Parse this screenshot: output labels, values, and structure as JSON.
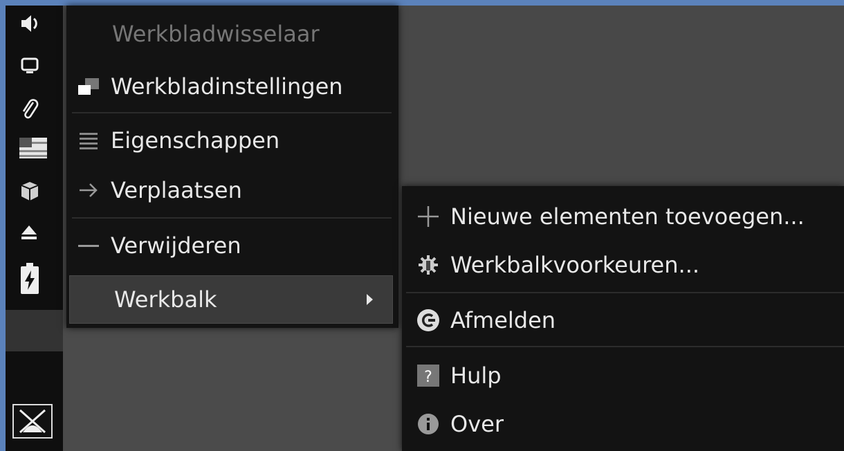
{
  "panel": {
    "icons": [
      "volume-icon",
      "display-icon",
      "paperclip-icon",
      "flag-icon",
      "package-icon",
      "eject-icon",
      "battery-icon"
    ],
    "logo": "xfce-logo-icon"
  },
  "menu": {
    "title": "Werkbladwisselaar",
    "items": [
      {
        "label": "Werkbladinstellingen",
        "icon": "desktop-settings-icon"
      },
      {
        "label": "Eigenschappen",
        "icon": "properties-icon"
      },
      {
        "label": "Verplaatsen",
        "icon": "arrow-right-icon"
      },
      {
        "label": "Verwijderen",
        "icon": "minus-icon"
      },
      {
        "label": "Werkbalk",
        "icon": "",
        "has_submenu": true
      }
    ]
  },
  "submenu": {
    "items": [
      {
        "label": "Nieuwe elementen toevoegen...",
        "icon": "plus-icon"
      },
      {
        "label": "Werkbalkvoorkeuren...",
        "icon": "gear-icon"
      },
      {
        "label": "Afmelden",
        "icon": "logout-icon"
      },
      {
        "label": "Hulp",
        "icon": "help-icon"
      },
      {
        "label": "Over",
        "icon": "info-icon"
      }
    ]
  },
  "colors": {
    "frame": "#5b82bb",
    "menu_bg": "#131313",
    "panel_bg": "#0f0f0f",
    "active_bg": "#3a3a3a",
    "title_text": "#767676"
  }
}
